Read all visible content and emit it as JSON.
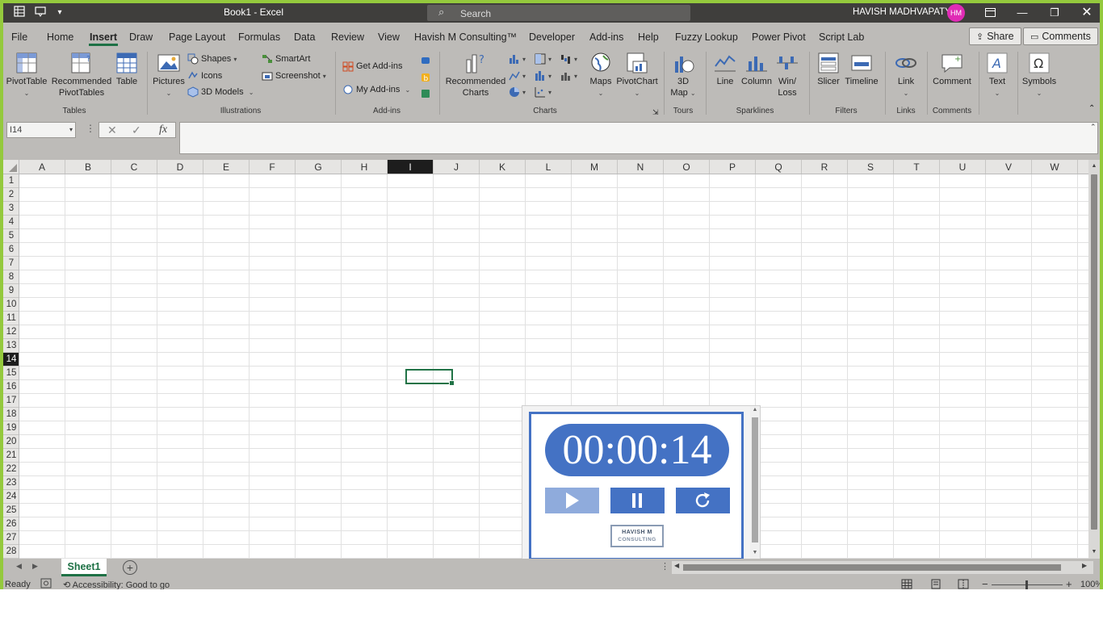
{
  "window": {
    "doc_title": "Book1  -  Excel",
    "search_placeholder": "Search",
    "user_name": "HAVISH MADHVAPATY",
    "user_initials": "HM"
  },
  "menu": {
    "items": [
      "File",
      "Home",
      "Insert",
      "Draw",
      "Page Layout",
      "Formulas",
      "Data",
      "Review",
      "View",
      "Havish M Consulting™",
      "Developer",
      "Add-ins",
      "Help",
      "Fuzzy Lookup",
      "Power Pivot",
      "Script Lab"
    ],
    "active": "Insert",
    "share_label": "Share",
    "comments_label": "Comments"
  },
  "ribbon": {
    "tables": {
      "label": "Tables",
      "pivottable": "PivotTable",
      "recommended_pivottables_1": "Recommended",
      "recommended_pivottables_2": "PivotTables",
      "table": "Table"
    },
    "illustrations": {
      "label": "Illustrations",
      "pictures": "Pictures",
      "shapes": "Shapes",
      "icons": "Icons",
      "models_3d": "3D Models",
      "smartart": "SmartArt",
      "screenshot": "Screenshot"
    },
    "addins": {
      "label": "Add-ins",
      "get_addins": "Get Add-ins",
      "my_addins": "My Add-ins"
    },
    "charts": {
      "label": "Charts",
      "recommended_1": "Recommended",
      "recommended_2": "Charts",
      "maps": "Maps",
      "pivotchart": "PivotChart"
    },
    "tours": {
      "label": "Tours",
      "map3d_1": "3D",
      "map3d_2": "Map"
    },
    "sparklines": {
      "label": "Sparklines",
      "line": "Line",
      "column": "Column",
      "winloss_1": "Win/",
      "winloss_2": "Loss"
    },
    "filters": {
      "label": "Filters",
      "slicer": "Slicer",
      "timeline": "Timeline"
    },
    "links": {
      "label": "Links",
      "link": "Link"
    },
    "comments": {
      "label": "Comments",
      "comment": "Comment"
    },
    "text": {
      "text": "Text"
    },
    "symbols": {
      "symbols": "Symbols"
    }
  },
  "formula_bar": {
    "name_box": "I14",
    "fx": "fx",
    "value": ""
  },
  "grid": {
    "columns": [
      "A",
      "B",
      "C",
      "D",
      "E",
      "F",
      "G",
      "H",
      "I",
      "J",
      "K",
      "L",
      "M",
      "N",
      "O",
      "P",
      "Q",
      "R",
      "S",
      "T",
      "U",
      "V",
      "W"
    ],
    "rows": [
      "1",
      "2",
      "3",
      "4",
      "5",
      "6",
      "7",
      "8",
      "9",
      "10",
      "11",
      "12",
      "13",
      "14",
      "15",
      "16",
      "17",
      "18",
      "19",
      "20",
      "21",
      "22",
      "23",
      "24",
      "25",
      "26",
      "27",
      "28"
    ],
    "selected_column": "I",
    "selected_row": "14"
  },
  "widget": {
    "timer": "00:00:14",
    "logo_line1": "HAVISH M",
    "logo_line2": "CONSULTING",
    "accent_color": "#4472c4"
  },
  "sheets": {
    "active": "Sheet1"
  },
  "status": {
    "ready": "Ready",
    "accessibility": "Accessibility: Good to go",
    "zoom": "100%"
  }
}
